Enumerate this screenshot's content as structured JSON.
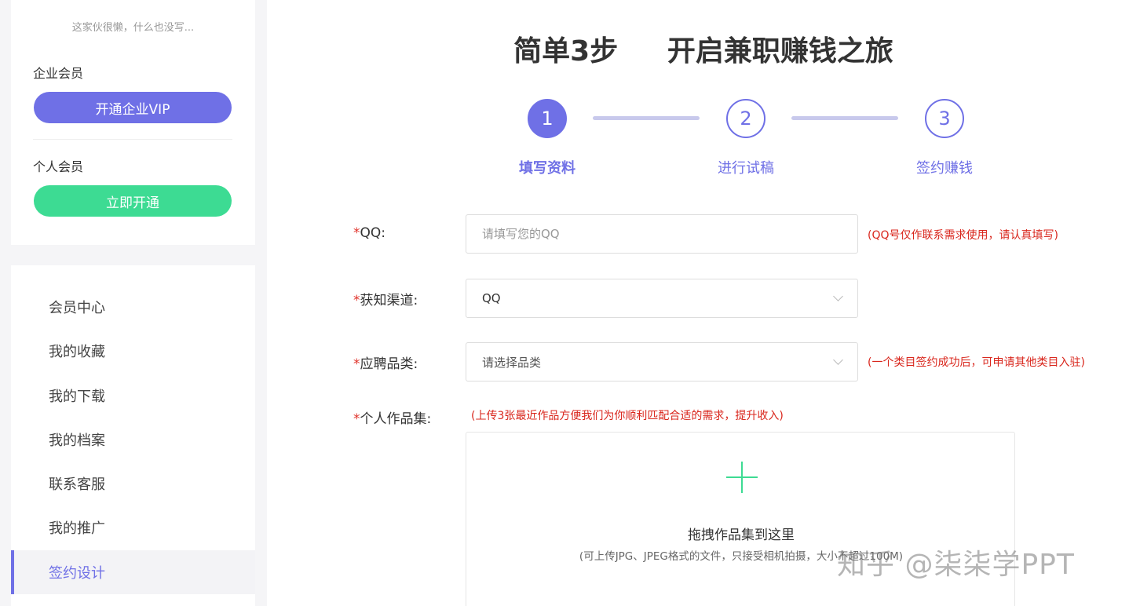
{
  "sidebar": {
    "tagline": "这家伙很懒，什么也没写...",
    "enterprise": {
      "label": "企业会员",
      "button": "开通企业VIP"
    },
    "personal": {
      "label": "个人会员",
      "button": "立即开通"
    },
    "nav": [
      {
        "label": "会员中心"
      },
      {
        "label": "我的收藏"
      },
      {
        "label": "我的下载"
      },
      {
        "label": "我的档案"
      },
      {
        "label": "联系客服"
      },
      {
        "label": "我的推广"
      },
      {
        "label": "签约设计",
        "active": true
      }
    ]
  },
  "main": {
    "title": "简单3步     开启兼职赚钱之旅",
    "steps": [
      {
        "number": "1",
        "label": "填写资料",
        "current": true
      },
      {
        "number": "2",
        "label": "进行试稿"
      },
      {
        "number": "3",
        "label": "签约赚钱"
      }
    ],
    "form": {
      "qq": {
        "label": "QQ:",
        "placeholder": "请填写您的QQ",
        "hint": "(QQ号仅作联系需求使用，请认真填写)"
      },
      "channel": {
        "label": "获知渠道:",
        "value": "QQ"
      },
      "category": {
        "label": "应聘品类:",
        "value": "请选择品类",
        "hint": "(一个类目签约成功后，可申请其他类目入驻)"
      },
      "portfolio": {
        "label": "个人作品集:",
        "hint": "(上传3张最近作品方便我们为你顺利匹配合适的需求，提升收入)",
        "upload_title": "拖拽作品集到这里",
        "upload_sub": "(可上传JPG、JPEG格式的文件，只接受相机拍摄，大小不超过100M)"
      }
    }
  },
  "watermark": "知乎 @柒柒学PPT",
  "colors": {
    "accent": "#6f70e6",
    "green": "#3ddb93",
    "required": "#e0322a"
  }
}
